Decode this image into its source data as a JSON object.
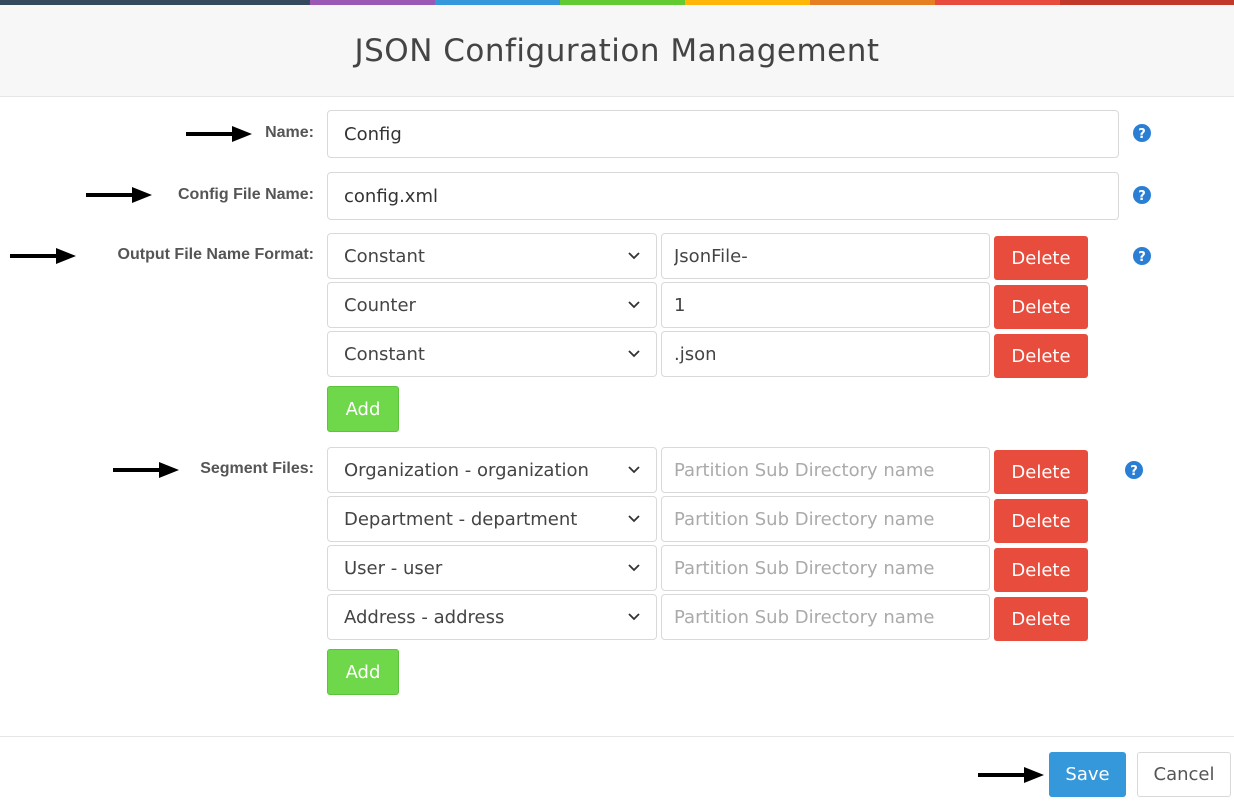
{
  "header": {
    "title": "JSON Configuration Management",
    "accent_colors": [
      "#34495e",
      "#9b59b6",
      "#3498db",
      "#62cb31",
      "#ffb606",
      "#e67e22",
      "#e74c3c",
      "#c0392b"
    ]
  },
  "form": {
    "name": {
      "label": "Name:",
      "value": "Config"
    },
    "config_file_name": {
      "label": "Config File Name:",
      "value": "config.xml"
    },
    "output_file_name_format": {
      "label": "Output File Name Format:",
      "rows": [
        {
          "type": "Constant",
          "value": "JsonFile-",
          "delete_label": "Delete"
        },
        {
          "type": "Counter",
          "value": "1",
          "delete_label": "Delete"
        },
        {
          "type": "Constant",
          "value": ".json",
          "delete_label": "Delete"
        }
      ],
      "add_label": "Add"
    },
    "segment_files": {
      "label": "Segment Files:",
      "rows": [
        {
          "type": "Organization - organization",
          "placeholder": "Partition Sub Directory name",
          "delete_label": "Delete"
        },
        {
          "type": "Department - department",
          "placeholder": "Partition Sub Directory name",
          "delete_label": "Delete"
        },
        {
          "type": "User - user",
          "placeholder": "Partition Sub Directory name",
          "delete_label": "Delete"
        },
        {
          "type": "Address - address",
          "placeholder": "Partition Sub Directory name",
          "delete_label": "Delete"
        }
      ],
      "add_label": "Add"
    }
  },
  "footer": {
    "save_label": "Save",
    "cancel_label": "Cancel"
  },
  "colors": {
    "delete": "#e74c3c",
    "add": "#6fd84a",
    "save": "#3498db",
    "help": "#2a7fd4"
  },
  "icons": {
    "help": "question-circle-icon",
    "arrow": "arrow-right-icon",
    "chevron": "chevron-down-icon"
  }
}
